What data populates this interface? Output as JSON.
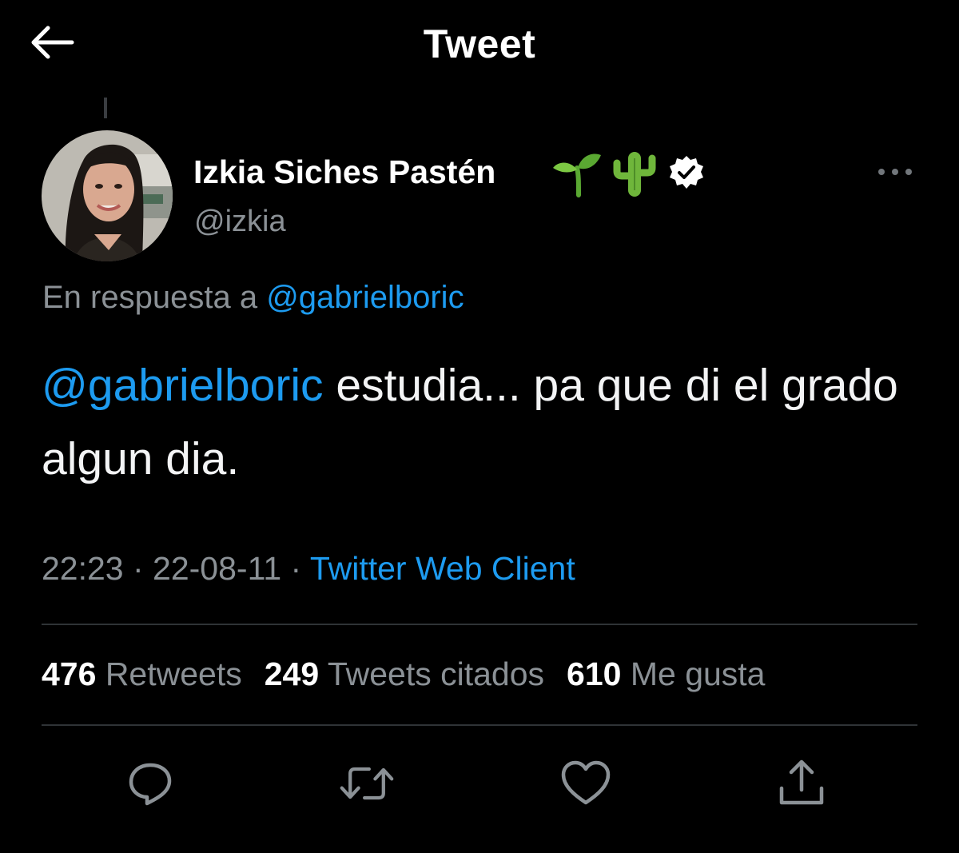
{
  "header": {
    "title": "Tweet",
    "back_icon": "back-arrow-icon"
  },
  "tweet": {
    "author": {
      "name": "Izkia Siches Pastén",
      "name_emojis": [
        "🌱",
        "🌵"
      ],
      "verified": true,
      "handle": "@izkia"
    },
    "reply_to": {
      "prefix": "En respuesta a ",
      "mention": "@gabrielboric"
    },
    "text": {
      "mention": "@gabrielboric",
      "body": " estudia... pa que di el grado algun dia."
    },
    "meta": {
      "time": "22:23",
      "separator": " · ",
      "date": "22-08-11",
      "source": "Twitter Web Client"
    },
    "stats": {
      "retweets_count": "476",
      "retweets_label": "Retweets",
      "quotes_count": "249",
      "quotes_label": "Tweets citados",
      "likes_count": "610",
      "likes_label": "Me gusta"
    }
  },
  "colors": {
    "background": "#000000",
    "accent": "#1d9bf0",
    "secondary_text": "#8b9196",
    "divider": "#2f3336"
  }
}
